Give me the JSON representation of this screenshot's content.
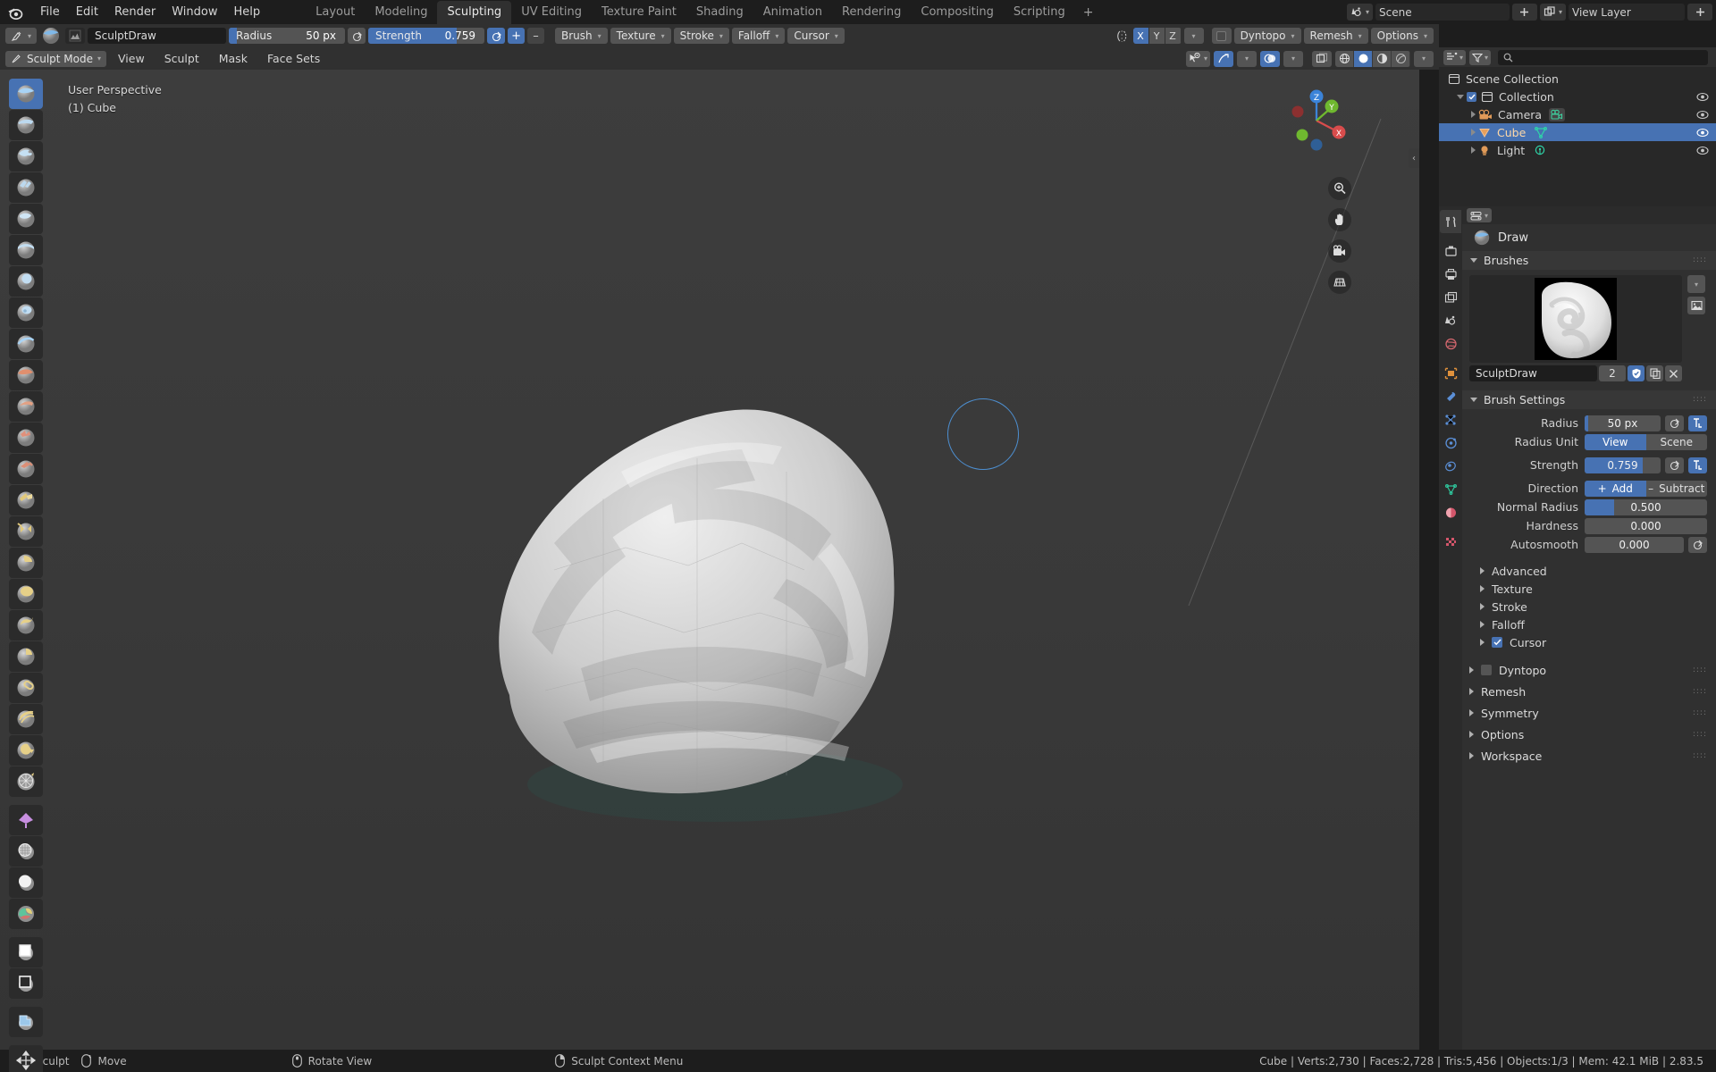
{
  "topbar": {
    "logo_icon": "blender-logo-icon",
    "menus": [
      "File",
      "Edit",
      "Render",
      "Window",
      "Help"
    ],
    "workspace_tabs": [
      {
        "label": "Layout",
        "active": false
      },
      {
        "label": "Modeling",
        "active": false
      },
      {
        "label": "Sculpting",
        "active": true
      },
      {
        "label": "UV Editing",
        "active": false
      },
      {
        "label": "Texture Paint",
        "active": false
      },
      {
        "label": "Shading",
        "active": false
      },
      {
        "label": "Animation",
        "active": false
      },
      {
        "label": "Rendering",
        "active": false
      },
      {
        "label": "Compositing",
        "active": false
      },
      {
        "label": "Scripting",
        "active": false
      }
    ],
    "add_workspace_label": "+",
    "scene_label": "Scene",
    "view_layer_label": "View Layer",
    "scene_icon": "scene-icon",
    "view_layer_icon": "view-layer-icon"
  },
  "tool_settings": {
    "tool_icon": "sculpt-tool-icon",
    "brush_preview_icon": "brush-sphere-icon",
    "texture_icon": "texture-thumbnail-icon",
    "brush_name": "SculptDraw",
    "radius_label": "Radius",
    "radius_value": "50 px",
    "radius_fill_pct": 7,
    "strength_label": "Strength",
    "strength_value": "0.759",
    "strength_fill_pct": 76,
    "add_label": "+",
    "subtract_label": "–",
    "dropdowns": [
      "Brush",
      "Texture",
      "Stroke",
      "Falloff",
      "Cursor"
    ],
    "symmetry_icon": "symmetry-icon",
    "axes": [
      {
        "label": "X",
        "on": true
      },
      {
        "label": "Y",
        "on": false
      },
      {
        "label": "Z",
        "on": false
      }
    ],
    "dyntopo_label": "Dyntopo",
    "dyntopo_checked": false,
    "remesh_label": "Remesh",
    "options_label": "Options"
  },
  "viewport_header": {
    "mode_label": "Sculpt Mode",
    "mode_icon": "sculpt-mode-icon",
    "menus": [
      "View",
      "Sculpt",
      "Mask",
      "Face Sets"
    ],
    "visibility_icon": "object-visibility-icon",
    "gizmo_icon": "gizmo-icon",
    "overlays_icon": "overlays-icon",
    "xray_icon": "xray-toggle-icon",
    "shading_modes": [
      {
        "name": "wireframe-shading-icon",
        "on": false
      },
      {
        "name": "solid-shading-icon",
        "on": true
      },
      {
        "name": "material-preview-shading-icon",
        "on": false
      },
      {
        "name": "rendered-shading-icon",
        "on": false
      }
    ]
  },
  "viewport": {
    "perspective_label": "User Perspective",
    "object_label": "(1) Cube",
    "gizmo_axes": [
      "X",
      "Y",
      "Z"
    ],
    "nav_buttons": [
      "zoom-icon",
      "pan-hand-icon",
      "camera-view-icon",
      "toggle-perspective-icon"
    ],
    "collapse_arrow_icon": "sidebar-collapse-icon",
    "brush_cursor": "brush-cursor-circle"
  },
  "left_toolbar": {
    "tools": [
      {
        "name": "draw-brush-tool",
        "active": true
      },
      {
        "name": "draw-sharp-brush-tool",
        "active": false
      },
      {
        "name": "clay-brush-tool",
        "active": false
      },
      {
        "name": "clay-strips-brush-tool",
        "active": false
      },
      {
        "name": "clay-thumb-brush-tool",
        "active": false
      },
      {
        "name": "layer-brush-tool",
        "active": false
      },
      {
        "name": "inflate-brush-tool",
        "active": false
      },
      {
        "name": "blob-brush-tool",
        "active": false
      },
      {
        "name": "crease-brush-tool",
        "active": false
      },
      {
        "name": "smooth-brush-tool",
        "active": false
      },
      {
        "name": "flatten-brush-tool",
        "active": false
      },
      {
        "name": "fill-brush-tool",
        "active": false
      },
      {
        "name": "scrape-brush-tool",
        "active": false
      },
      {
        "name": "multiplane-scrape-brush-tool",
        "active": false
      },
      {
        "name": "pinch-brush-tool",
        "active": false
      },
      {
        "name": "grab-brush-tool",
        "active": false
      },
      {
        "name": "elastic-deform-brush-tool",
        "active": false
      },
      {
        "name": "snake-hook-brush-tool",
        "active": false
      },
      {
        "name": "thumb-brush-tool",
        "active": false
      },
      {
        "name": "pose-brush-tool",
        "active": false
      },
      {
        "name": "nudge-brush-tool",
        "active": false
      },
      {
        "name": "rotate-brush-tool",
        "active": false
      },
      {
        "name": "slide-relax-brush-tool",
        "active": false
      },
      {
        "name": "simplify-brush-tool",
        "active": false
      },
      {
        "name": "mask-brush-tool",
        "active": false
      },
      {
        "name": "draw-face-sets-tool",
        "active": false
      },
      {
        "name": "box-mask-tool",
        "active": false
      },
      {
        "name": "line-mask-tool",
        "active": false
      },
      {
        "name": "box-hide-tool",
        "active": false
      },
      {
        "name": "move-transform-tool",
        "active": false
      }
    ]
  },
  "outliner": {
    "display_mode_icon": "outliner-display-mode-icon",
    "filter_icon": "filter-icon",
    "search_icon": "search-icon",
    "search_placeholder": "",
    "rows": [
      {
        "label": "Scene Collection",
        "icon": "scene-collection-icon",
        "indent": 0,
        "selected": false,
        "has_toggle": false,
        "has_eye": false
      },
      {
        "label": "Collection",
        "icon": "collection-icon",
        "indent": 1,
        "selected": false,
        "has_toggle": true,
        "has_eye": true,
        "checked": true
      },
      {
        "label": "Camera",
        "icon": "camera-object-icon",
        "data_icon": "camera-data-icon",
        "indent": 2,
        "selected": false,
        "has_toggle": false,
        "has_eye": true
      },
      {
        "label": "Cube",
        "icon": "mesh-object-icon",
        "data_icon": "mesh-data-icon",
        "indent": 2,
        "selected": true,
        "has_toggle": false,
        "has_eye": true
      },
      {
        "label": "Light",
        "icon": "light-object-icon",
        "data_icon": "light-data-icon",
        "indent": 2,
        "selected": false,
        "has_toggle": false,
        "has_eye": true
      }
    ]
  },
  "properties": {
    "tabs": [
      {
        "name": "tool-properties-tab",
        "active": true,
        "color": "#cfcfcf"
      },
      {
        "name": "render-properties-tab",
        "active": false,
        "color": "#cfcfcf"
      },
      {
        "name": "output-properties-tab",
        "active": false,
        "color": "#cfcfcf"
      },
      {
        "name": "view-layer-properties-tab",
        "active": false,
        "color": "#cfcfcf"
      },
      {
        "name": "scene-properties-tab",
        "active": false,
        "color": "#cfcfcf"
      },
      {
        "name": "world-properties-tab",
        "active": false,
        "color": "#d46a6a"
      },
      {
        "name": "object-properties-tab",
        "active": false,
        "color": "#e0913c"
      },
      {
        "name": "modifier-properties-tab",
        "active": false,
        "color": "#5b8fd6"
      },
      {
        "name": "particle-properties-tab",
        "active": false,
        "color": "#5b8fd6"
      },
      {
        "name": "physics-properties-tab",
        "active": false,
        "color": "#5b8fd6"
      },
      {
        "name": "constraint-properties-tab",
        "active": false,
        "color": "#5b8fd6"
      },
      {
        "name": "object-data-properties-tab",
        "active": false,
        "color": "#2fc39a"
      },
      {
        "name": "material-properties-tab",
        "active": false,
        "color": "#d4566b"
      },
      {
        "name": "texture-properties-tab",
        "active": false,
        "color": "#d4566b"
      }
    ],
    "brush_header": {
      "icon": "draw-brush-icon",
      "label": "Draw"
    },
    "brushes_panel": {
      "label": "Brushes",
      "open": true,
      "preview_icon": "brush-texture-preview",
      "brush_name": "SculptDraw",
      "user_count": "2",
      "fake_user_icon": "shield-icon",
      "duplicate_icon": "copy-icon",
      "unlink_icon": "close-icon",
      "expand_icon": "chevron-down-icon",
      "image_icon": "image-icon"
    },
    "brush_settings_panel": {
      "label": "Brush Settings",
      "open": true,
      "rows": [
        {
          "name": "radius",
          "label": "Radius",
          "value": "50 px",
          "fill_pct": 5,
          "type": "slider",
          "icons": [
            "pressure-icon",
            "unified-icon"
          ],
          "unified_on": true
        },
        {
          "name": "radius-unit",
          "label": "Radius Unit",
          "type": "toggle2",
          "options": [
            "View",
            "Scene"
          ],
          "selected": "View"
        },
        {
          "name": "strength",
          "label": "Strength",
          "value": "0.759",
          "fill_pct": 76,
          "type": "slider",
          "icons": [
            "pressure-icon",
            "unified-icon"
          ],
          "unified_on": false
        },
        {
          "name": "direction",
          "label": "Direction",
          "type": "toggle2",
          "options": [
            "Add",
            "Subtract"
          ],
          "selected": "Add",
          "prefix": [
            "+",
            "–"
          ]
        },
        {
          "name": "normal-radius",
          "label": "Normal Radius",
          "value": "0.500",
          "fill_pct": 24,
          "type": "slider",
          "icons": []
        },
        {
          "name": "hardness",
          "label": "Hardness",
          "value": "0.000",
          "fill_pct": 0,
          "type": "slider",
          "icons": []
        },
        {
          "name": "autosmooth",
          "label": "Autosmooth",
          "value": "0.000",
          "fill_pct": 0,
          "type": "slider",
          "icons": [
            "pressure-icon"
          ]
        }
      ],
      "subpanels": [
        {
          "label": "Advanced",
          "checkbox": null
        },
        {
          "label": "Texture",
          "checkbox": null
        },
        {
          "label": "Stroke",
          "checkbox": null
        },
        {
          "label": "Falloff",
          "checkbox": null
        },
        {
          "label": "Cursor",
          "checkbox": true
        }
      ]
    },
    "top_panels": [
      {
        "label": "Dyntopo",
        "checkbox": false
      },
      {
        "label": "Remesh",
        "checkbox": null
      },
      {
        "label": "Symmetry",
        "checkbox": null
      },
      {
        "label": "Options",
        "checkbox": null
      },
      {
        "label": "Workspace",
        "checkbox": null
      }
    ]
  },
  "statusbar": {
    "hints": [
      {
        "icon": "mouse-left-icon",
        "label": "Sculpt"
      },
      {
        "icon": "mouse-move-icon",
        "label": "Move"
      },
      {
        "icon": "mouse-middle-icon",
        "label": "Rotate View"
      },
      {
        "icon": "mouse-right-icon",
        "label": "Sculpt Context Menu"
      }
    ],
    "stats": "Cube | Verts:2,730 | Faces:2,728 | Tris:5,456 | Objects:1/3 | Mem: 42.1 MiB | 2.83.5"
  },
  "colors": {
    "accent_blue": "#4772b3",
    "panel_bg": "#303030",
    "editor_bg": "#282828",
    "window_bg": "#1d1d1d",
    "viewport_bg": "#3b3b3b",
    "selected_orange": "#ed9e5c"
  }
}
